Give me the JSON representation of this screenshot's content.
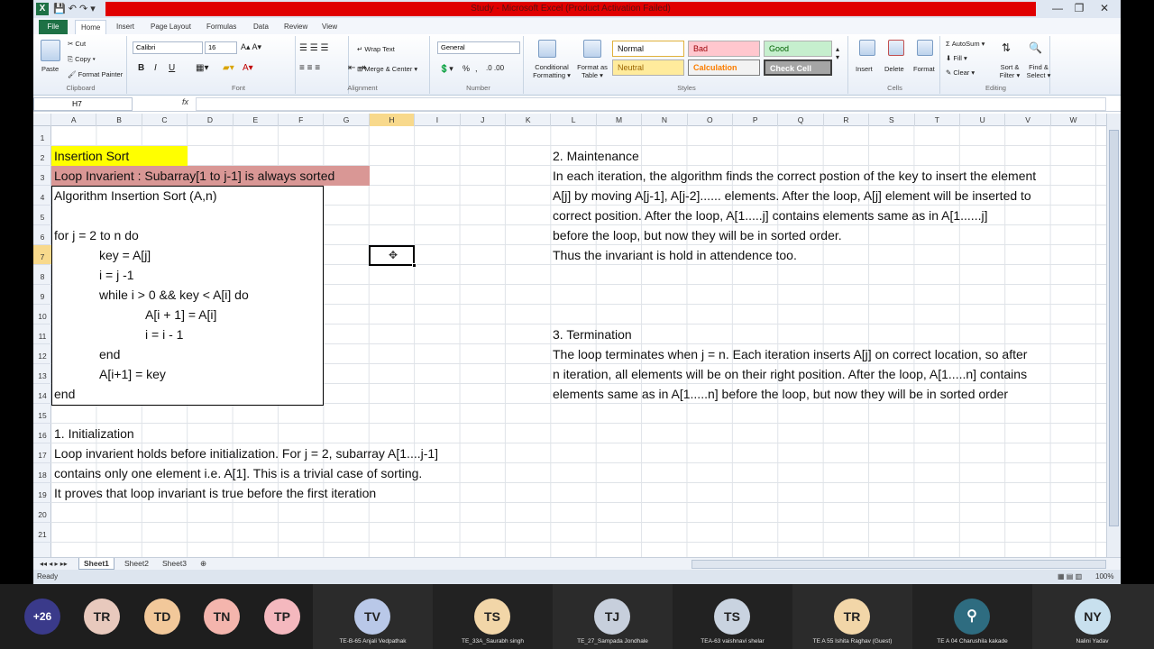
{
  "window": {
    "title": "Study - Microsoft Excel (Product Activation Failed)",
    "minimize": "—",
    "restore": "❐",
    "close": "✕"
  },
  "ribbon_tabs": [
    "File",
    "Home",
    "Insert",
    "Page Layout",
    "Formulas",
    "Data",
    "Review",
    "View"
  ],
  "ribbon": {
    "clipboard": {
      "paste": "Paste",
      "cut": "Cut",
      "copy": "Copy ▾",
      "format_painter": "Format Painter",
      "label": "Clipboard"
    },
    "font": {
      "name": "Calibri",
      "size": "16",
      "bold": "B",
      "italic": "I",
      "underline": "U",
      "label": "Font"
    },
    "alignment": {
      "wrap": "Wrap Text",
      "merge": "Merge & Center ▾",
      "label": "Alignment"
    },
    "number": {
      "format": "General",
      "percent": "%",
      "comma": ",",
      "label": "Number"
    },
    "styles": {
      "conditional": "Conditional Formatting ▾",
      "format_table": "Format as Table ▾",
      "normal": "Normal",
      "bad": "Bad",
      "good": "Good",
      "neutral": "Neutral",
      "calculation": "Calculation",
      "check_cell": "Check Cell",
      "label": "Styles"
    },
    "cells": {
      "insert": "Insert",
      "delete": "Delete",
      "format": "Format",
      "label": "Cells"
    },
    "editing": {
      "autosum": "AutoSum ▾",
      "fill": "Fill ▾",
      "clear": "Clear ▾",
      "sort": "Sort & Filter ▾",
      "find": "Find & Select ▾",
      "label": "Editing"
    }
  },
  "formula_bar": {
    "name_box": "H7",
    "fx": "fx",
    "value": ""
  },
  "columns": [
    "A",
    "B",
    "C",
    "D",
    "E",
    "F",
    "G",
    "H",
    "I",
    "J",
    "K",
    "L",
    "M",
    "N",
    "O",
    "P",
    "Q",
    "R",
    "S",
    "T",
    "U",
    "V",
    "W"
  ],
  "rows": [
    "1",
    "2",
    "3",
    "4",
    "5",
    "6",
    "7",
    "8",
    "9",
    "10",
    "11",
    "12",
    "13",
    "14",
    "15",
    "16",
    "17",
    "18",
    "19",
    "20",
    "21"
  ],
  "selected_cell": {
    "column": "H",
    "row": "7"
  },
  "sheet": {
    "title": "Insertion Sort",
    "invariant": "Loop Invarient : Subarray[1 to j-1] is always sorted",
    "algo": [
      "Algorithm Insertion Sort (A,n)",
      "for j = 2 to n do",
      "key = A[j]",
      "i = j -1",
      "while i > 0 && key < A[i] do",
      "A[i + 1] = A[i]",
      "i = i - 1",
      "end",
      "A[i+1] = key",
      "end"
    ],
    "init": [
      "1. Initialization",
      "Loop invarient holds before initialization. For j = 2, subarray A[1....j-1]",
      "contains only one element i.e. A[1]. This is a trivial case of sorting.",
      "It proves that loop invariant is true before the first iteration"
    ],
    "maint": [
      "2. Maintenance",
      "In each iteration, the algorithm finds the correct postion of the key to insert the element",
      "A[j] by moving A[j-1], A[j-2]...... elements. After the loop, A[j] element will be inserted to",
      "correct position. After the loop, A[1.....j] contains elements same as in A[1......j]",
      "before the loop, but now they will be in sorted order.",
      "Thus the invariant is hold in attendence too."
    ],
    "term": [
      "3. Termination",
      "The loop terminates when j = n. Each iteration inserts A[j] on correct location, so after",
      "n iteration, all elements will be on their right position. After the loop, A[1.....n] contains",
      "elements same as in A[1.....n] before the loop, but now they will be in sorted order"
    ]
  },
  "sheet_tabs": [
    "Sheet1",
    "Sheet2",
    "Sheet3"
  ],
  "status": {
    "ready": "Ready",
    "zoom": "100%"
  },
  "meeting": {
    "more_count": "+26",
    "avatars": [
      {
        "initials": "TR",
        "color": "#e8c9bd"
      },
      {
        "initials": "TD",
        "color": "#f2c89a"
      },
      {
        "initials": "TN",
        "color": "#f4b5ad"
      },
      {
        "initials": "TP",
        "color": "#f4b8be"
      }
    ],
    "tiles": [
      {
        "initials": "TV",
        "name": "TE-B-65 Anjali Vedpathak",
        "color": "#b9c8e8"
      },
      {
        "initials": "TS",
        "name": "TE_33A_Saurabh singh",
        "color": "#f2d6a8"
      },
      {
        "initials": "TJ",
        "name": "TE_27_Sampada Jondhale",
        "color": "#c7cfdc"
      },
      {
        "initials": "TS",
        "name": "TEA-63 vaishnavi shelar",
        "color": "#c9d3e0"
      },
      {
        "initials": "TR",
        "name": "TE A 55 Ishita Raghav (Guest)",
        "color": "#f2d6a8"
      },
      {
        "initials": "",
        "name": "TE A 04 Charushila kakade",
        "color": "#2e6c80"
      },
      {
        "initials": "NY",
        "name": "Nalini Yadav",
        "color": "#c8e0ee"
      }
    ],
    "colors": {
      "more_bg": "#3a3a8a"
    }
  }
}
